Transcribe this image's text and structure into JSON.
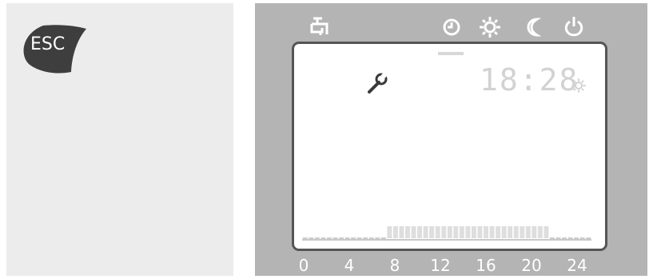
{
  "esc_button": {
    "label": "ESC"
  },
  "mode_icons": [
    "hot-water-tap-icon",
    "clock-icon",
    "sun-icon",
    "moon-icon",
    "power-icon"
  ],
  "display": {
    "time": "18:28",
    "wrench_icon": "wrench-icon",
    "status_icon": "sun-icon"
  },
  "schedule": {
    "active_from_hour": 7,
    "active_to_hour": 20.5
  },
  "hour_labels": [
    "0",
    "4",
    "8",
    "12",
    "16",
    "20",
    "24"
  ]
}
